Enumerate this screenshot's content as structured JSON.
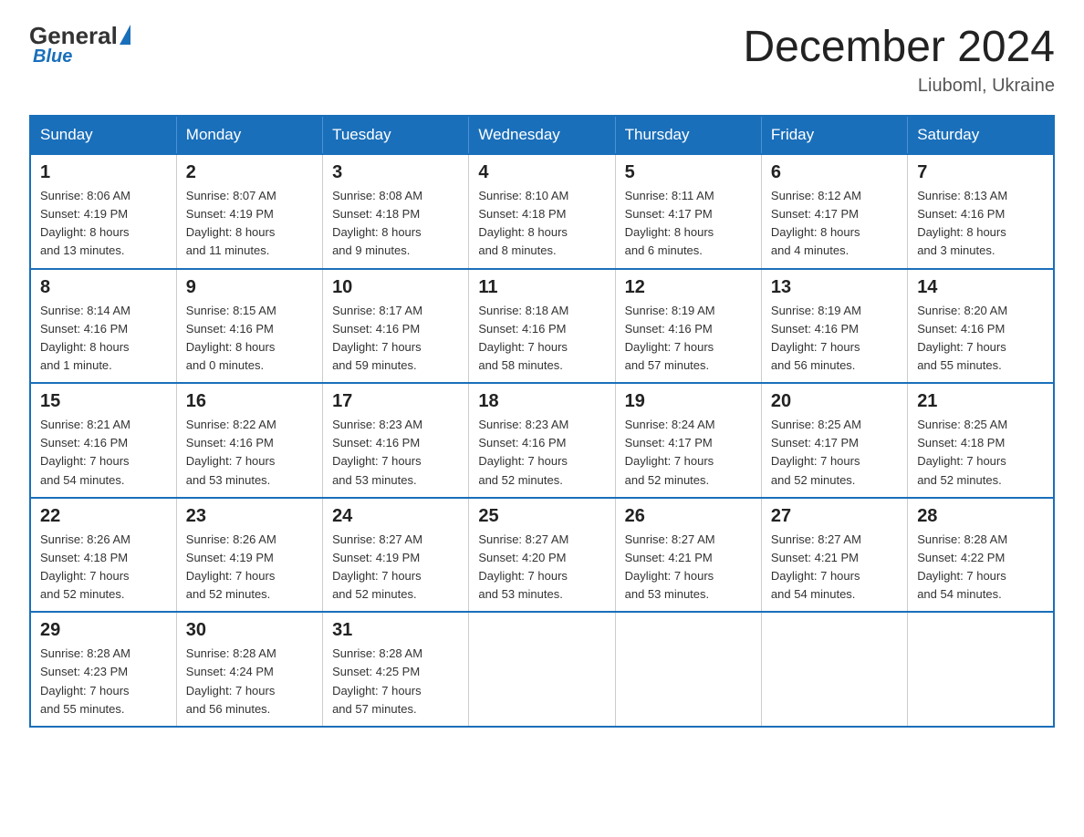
{
  "header": {
    "title": "December 2024",
    "subtitle": "Liuboml, Ukraine",
    "logo_general": "General",
    "logo_blue": "Blue"
  },
  "days_of_week": [
    "Sunday",
    "Monday",
    "Tuesday",
    "Wednesday",
    "Thursday",
    "Friday",
    "Saturday"
  ],
  "weeks": [
    [
      {
        "day": "1",
        "info": "Sunrise: 8:06 AM\nSunset: 4:19 PM\nDaylight: 8 hours\nand 13 minutes."
      },
      {
        "day": "2",
        "info": "Sunrise: 8:07 AM\nSunset: 4:19 PM\nDaylight: 8 hours\nand 11 minutes."
      },
      {
        "day": "3",
        "info": "Sunrise: 8:08 AM\nSunset: 4:18 PM\nDaylight: 8 hours\nand 9 minutes."
      },
      {
        "day": "4",
        "info": "Sunrise: 8:10 AM\nSunset: 4:18 PM\nDaylight: 8 hours\nand 8 minutes."
      },
      {
        "day": "5",
        "info": "Sunrise: 8:11 AM\nSunset: 4:17 PM\nDaylight: 8 hours\nand 6 minutes."
      },
      {
        "day": "6",
        "info": "Sunrise: 8:12 AM\nSunset: 4:17 PM\nDaylight: 8 hours\nand 4 minutes."
      },
      {
        "day": "7",
        "info": "Sunrise: 8:13 AM\nSunset: 4:16 PM\nDaylight: 8 hours\nand 3 minutes."
      }
    ],
    [
      {
        "day": "8",
        "info": "Sunrise: 8:14 AM\nSunset: 4:16 PM\nDaylight: 8 hours\nand 1 minute."
      },
      {
        "day": "9",
        "info": "Sunrise: 8:15 AM\nSunset: 4:16 PM\nDaylight: 8 hours\nand 0 minutes."
      },
      {
        "day": "10",
        "info": "Sunrise: 8:17 AM\nSunset: 4:16 PM\nDaylight: 7 hours\nand 59 minutes."
      },
      {
        "day": "11",
        "info": "Sunrise: 8:18 AM\nSunset: 4:16 PM\nDaylight: 7 hours\nand 58 minutes."
      },
      {
        "day": "12",
        "info": "Sunrise: 8:19 AM\nSunset: 4:16 PM\nDaylight: 7 hours\nand 57 minutes."
      },
      {
        "day": "13",
        "info": "Sunrise: 8:19 AM\nSunset: 4:16 PM\nDaylight: 7 hours\nand 56 minutes."
      },
      {
        "day": "14",
        "info": "Sunrise: 8:20 AM\nSunset: 4:16 PM\nDaylight: 7 hours\nand 55 minutes."
      }
    ],
    [
      {
        "day": "15",
        "info": "Sunrise: 8:21 AM\nSunset: 4:16 PM\nDaylight: 7 hours\nand 54 minutes."
      },
      {
        "day": "16",
        "info": "Sunrise: 8:22 AM\nSunset: 4:16 PM\nDaylight: 7 hours\nand 53 minutes."
      },
      {
        "day": "17",
        "info": "Sunrise: 8:23 AM\nSunset: 4:16 PM\nDaylight: 7 hours\nand 53 minutes."
      },
      {
        "day": "18",
        "info": "Sunrise: 8:23 AM\nSunset: 4:16 PM\nDaylight: 7 hours\nand 52 minutes."
      },
      {
        "day": "19",
        "info": "Sunrise: 8:24 AM\nSunset: 4:17 PM\nDaylight: 7 hours\nand 52 minutes."
      },
      {
        "day": "20",
        "info": "Sunrise: 8:25 AM\nSunset: 4:17 PM\nDaylight: 7 hours\nand 52 minutes."
      },
      {
        "day": "21",
        "info": "Sunrise: 8:25 AM\nSunset: 4:18 PM\nDaylight: 7 hours\nand 52 minutes."
      }
    ],
    [
      {
        "day": "22",
        "info": "Sunrise: 8:26 AM\nSunset: 4:18 PM\nDaylight: 7 hours\nand 52 minutes."
      },
      {
        "day": "23",
        "info": "Sunrise: 8:26 AM\nSunset: 4:19 PM\nDaylight: 7 hours\nand 52 minutes."
      },
      {
        "day": "24",
        "info": "Sunrise: 8:27 AM\nSunset: 4:19 PM\nDaylight: 7 hours\nand 52 minutes."
      },
      {
        "day": "25",
        "info": "Sunrise: 8:27 AM\nSunset: 4:20 PM\nDaylight: 7 hours\nand 53 minutes."
      },
      {
        "day": "26",
        "info": "Sunrise: 8:27 AM\nSunset: 4:21 PM\nDaylight: 7 hours\nand 53 minutes."
      },
      {
        "day": "27",
        "info": "Sunrise: 8:27 AM\nSunset: 4:21 PM\nDaylight: 7 hours\nand 54 minutes."
      },
      {
        "day": "28",
        "info": "Sunrise: 8:28 AM\nSunset: 4:22 PM\nDaylight: 7 hours\nand 54 minutes."
      }
    ],
    [
      {
        "day": "29",
        "info": "Sunrise: 8:28 AM\nSunset: 4:23 PM\nDaylight: 7 hours\nand 55 minutes."
      },
      {
        "day": "30",
        "info": "Sunrise: 8:28 AM\nSunset: 4:24 PM\nDaylight: 7 hours\nand 56 minutes."
      },
      {
        "day": "31",
        "info": "Sunrise: 8:28 AM\nSunset: 4:25 PM\nDaylight: 7 hours\nand 57 minutes."
      },
      {
        "day": "",
        "info": ""
      },
      {
        "day": "",
        "info": ""
      },
      {
        "day": "",
        "info": ""
      },
      {
        "day": "",
        "info": ""
      }
    ]
  ]
}
